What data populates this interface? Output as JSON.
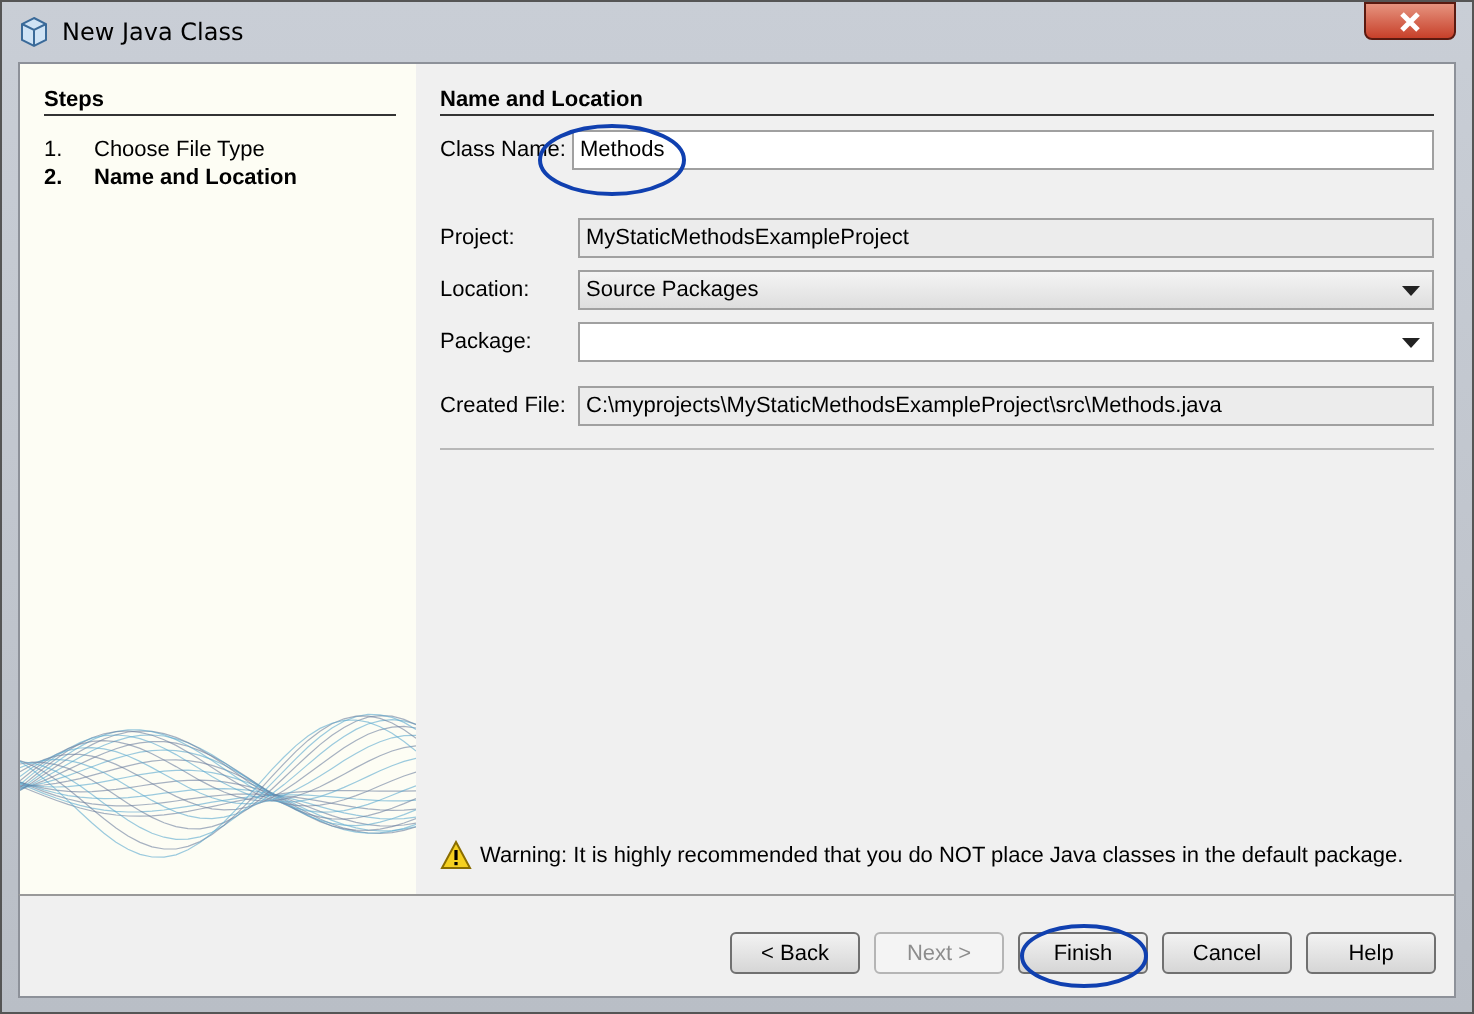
{
  "window": {
    "title": "New Java Class"
  },
  "steps": {
    "title": "Steps",
    "items": [
      {
        "number": "1.",
        "label": "Choose File Type",
        "selected": false
      },
      {
        "number": "2.",
        "label": "Name and Location",
        "selected": true
      }
    ]
  },
  "panel": {
    "title": "Name and Location",
    "fields": [
      {
        "kind": "input",
        "label": "Class Name:",
        "value": "Methods"
      },
      {
        "kind": "readonly",
        "label": "Project:",
        "value": "MyStaticMethodsExampleProject"
      },
      {
        "kind": "combo",
        "label": "Location:",
        "value": "Source Packages"
      },
      {
        "kind": "editcombo",
        "label": "Package:"
      },
      {
        "kind": "readonly",
        "label": "Created File:",
        "value": "C:\\myprojects\\MyStaticMethodsExampleProject\\src\\Methods.java"
      }
    ],
    "warning": "Warning: It is highly recommended that you do NOT place Java classes in the default package."
  },
  "buttons": [
    {
      "label": "< Back",
      "disabled": false
    },
    {
      "label": "Next >",
      "disabled": true
    },
    {
      "label": "Finish",
      "disabled": false
    },
    {
      "label": "Cancel",
      "disabled": false
    },
    {
      "label": "Help",
      "disabled": false
    }
  ]
}
